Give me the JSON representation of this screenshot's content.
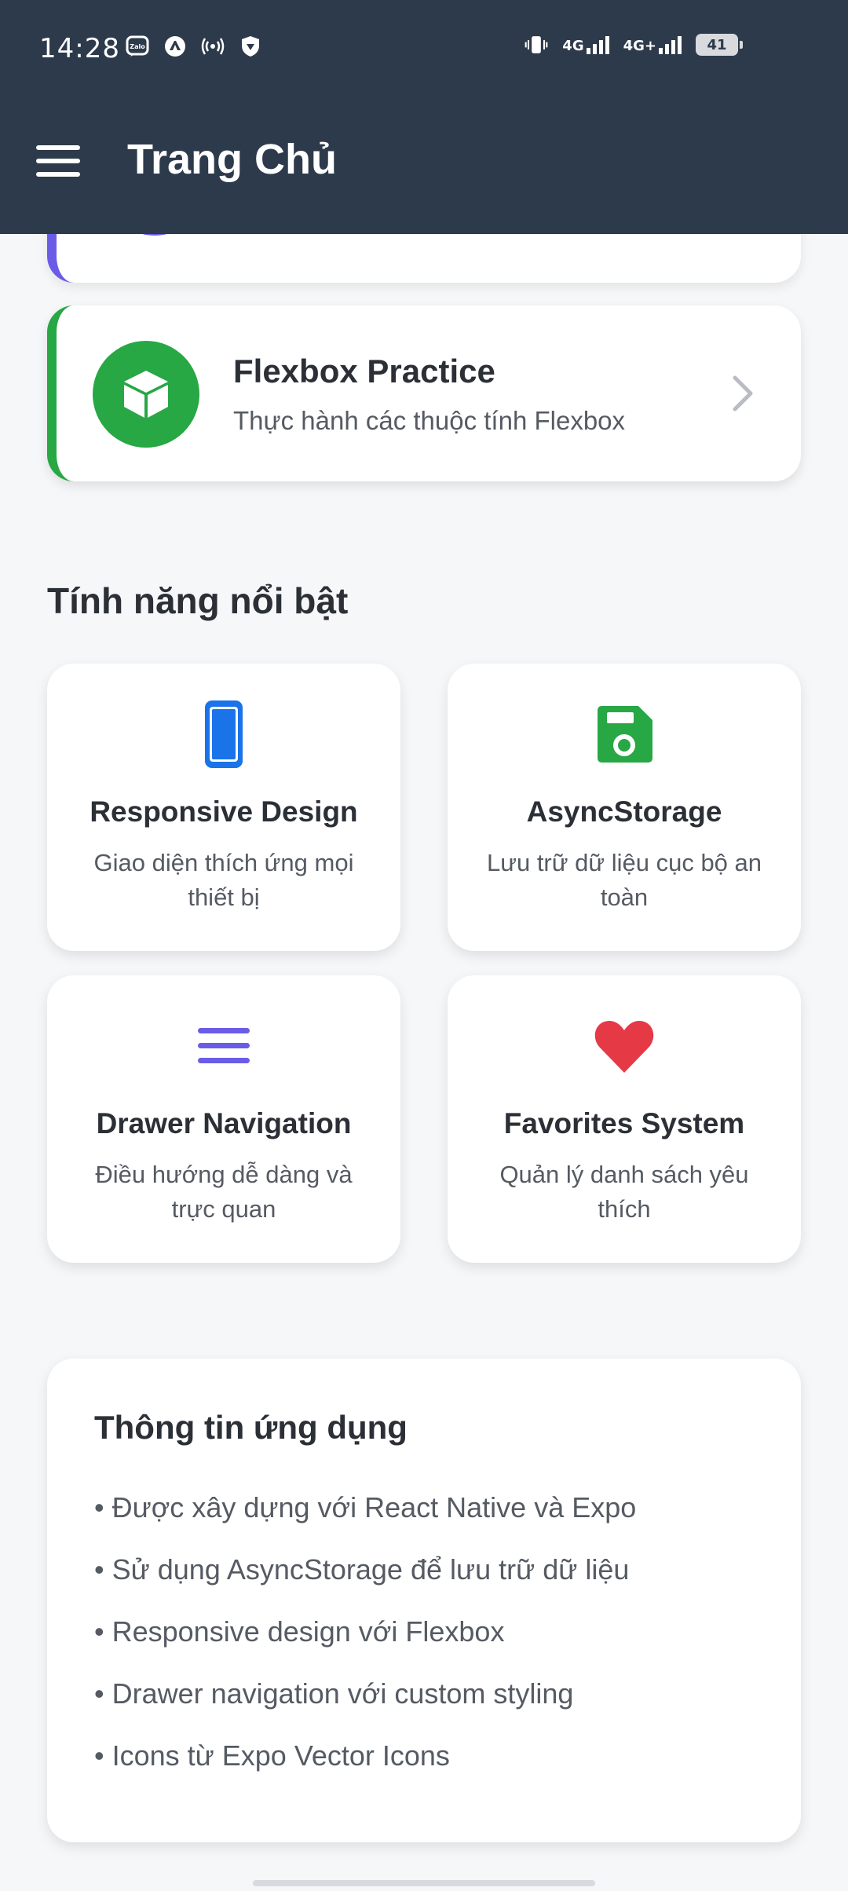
{
  "status_bar": {
    "time": "14:28",
    "left_icons": [
      "zalo-icon",
      "messenger-icon",
      "hotspot-icon",
      "vpn-shield-icon"
    ],
    "network_1": "4G",
    "network_2": "4G+",
    "battery": "41"
  },
  "app_bar": {
    "title": "Trang Chủ",
    "menu_icon": "hamburger-menu-icon"
  },
  "nav_card": {
    "title": "Flexbox Practice",
    "subtitle": "Thực hành các thuộc tính Flexbox",
    "icon": "cube-icon",
    "accent": "#28a745"
  },
  "partial_card_accent": "#6b5ce7",
  "features": {
    "section_title": "Tính năng nổi bật",
    "items": [
      {
        "title": "Responsive Design",
        "description": "Giao diện thích ứng mọi thiết bị",
        "icon": "phone-icon",
        "color": "#1a73e8"
      },
      {
        "title": "AsyncStorage",
        "description": "Lưu trữ dữ liệu cục bộ an toàn",
        "icon": "save-icon",
        "color": "#28a745"
      },
      {
        "title": "Drawer Navigation",
        "description": "Điều hướng dễ dàng và trực quan",
        "icon": "menu-icon",
        "color": "#6b5ce7"
      },
      {
        "title": "Favorites System",
        "description": "Quản lý danh sách yêu thích",
        "icon": "heart-icon",
        "color": "#e63946"
      }
    ]
  },
  "info": {
    "title": "Thông tin ứng dụng",
    "items": [
      "• Được xây dựng với React Native và Expo",
      "• Sử dụng AsyncStorage để lưu trữ dữ liệu",
      "• Responsive design với Flexbox",
      "• Drawer navigation với custom styling",
      "• Icons từ Expo Vector Icons"
    ]
  }
}
